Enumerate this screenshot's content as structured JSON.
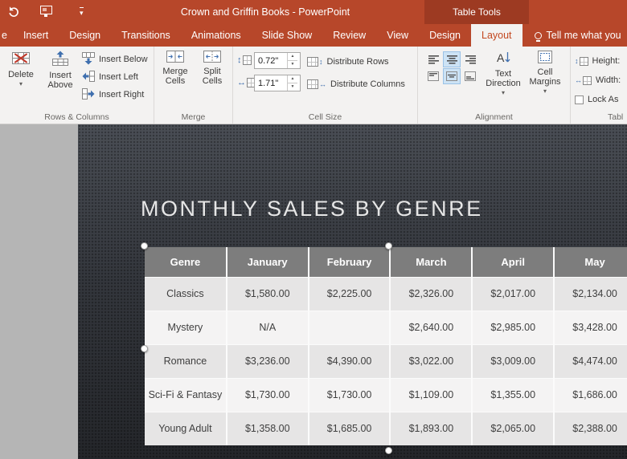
{
  "colors": {
    "titlebar_bg": "#b7472a",
    "context_header_bg": "#9d3a22",
    "active_tab_text": "#c3471f",
    "slide_bg": "#33363c",
    "table_header_bg": "#7d7d7d"
  },
  "titlebar": {
    "app_title": "Crown and Griffin Books - PowerPoint",
    "context_title": "Table Tools"
  },
  "tabs": {
    "file_partial": "e",
    "insert": "Insert",
    "design": "Design",
    "transitions": "Transitions",
    "animations": "Animations",
    "slide_show": "Slide Show",
    "review": "Review",
    "view": "View",
    "ctx_design": "Design",
    "ctx_layout": "Layout",
    "tell_me": "Tell me what you"
  },
  "ribbon": {
    "rows_columns": {
      "label": "Rows & Columns",
      "delete": "Delete",
      "insert_above": "Insert\nAbove",
      "insert_below": "Insert Below",
      "insert_left": "Insert Left",
      "insert_right": "Insert Right"
    },
    "merge": {
      "label": "Merge",
      "merge_cells": "Merge\nCells",
      "split_cells": "Split\nCells"
    },
    "cell_size": {
      "label": "Cell Size",
      "height_value": "0.72\"",
      "width_value": "1.71\"",
      "distribute_rows": "Distribute Rows",
      "distribute_columns": "Distribute Columns"
    },
    "alignment": {
      "label": "Alignment",
      "text_direction": "Text\nDirection",
      "cell_margins": "Cell\nMargins"
    },
    "table": {
      "label": "Tabl",
      "height": "Height:",
      "width": "Width:",
      "lock_aspect": "Lock As"
    }
  },
  "slide": {
    "title": "MONTHLY SALES BY GENRE",
    "table": {
      "headers": [
        "Genre",
        "January",
        "February",
        "March",
        "April",
        "May"
      ],
      "rows": [
        [
          "Classics",
          "$1,580.00",
          "$2,225.00",
          "$2,326.00",
          "$2,017.00",
          "$2,134.00"
        ],
        [
          "Mystery",
          "N/A",
          "",
          "$2,640.00",
          "$2,985.00",
          "$3,428.00"
        ],
        [
          "Romance",
          "$3,236.00",
          "$4,390.00",
          "$3,022.00",
          "$3,009.00",
          "$4,474.00"
        ],
        [
          "Sci-Fi & Fantasy",
          "$1,730.00",
          "$1,730.00",
          "$1,109.00",
          "$1,355.00",
          "$1,686.00"
        ],
        [
          "Young Adult",
          "$1,358.00",
          "$1,685.00",
          "$1,893.00",
          "$2,065.00",
          "$2,388.00"
        ]
      ]
    }
  }
}
